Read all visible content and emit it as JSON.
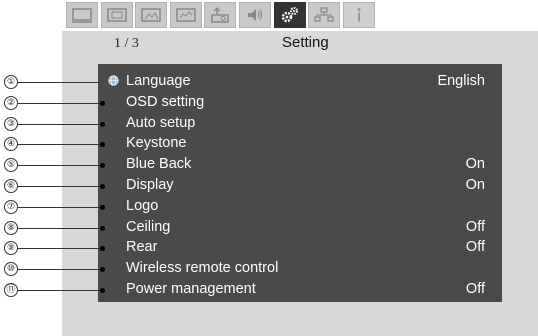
{
  "tabs": [
    {
      "icon": "picture-adjust-icon",
      "active": false
    },
    {
      "icon": "screen-adjust-icon",
      "active": false
    },
    {
      "icon": "image-icon",
      "active": false
    },
    {
      "icon": "input-select-icon",
      "active": false
    },
    {
      "icon": "projector-icon",
      "active": false
    },
    {
      "icon": "sound-icon",
      "active": false
    },
    {
      "icon": "setting-gears-icon",
      "active": true
    },
    {
      "icon": "network-icon",
      "active": false
    },
    {
      "icon": "info-icon",
      "active": false
    }
  ],
  "header": {
    "page_indicator": "1 / 3",
    "title": "Setting"
  },
  "menu": [
    {
      "callout": "①",
      "label": "Language",
      "value": "English"
    },
    {
      "callout": "②",
      "label": "OSD setting",
      "value": ""
    },
    {
      "callout": "③",
      "label": "Auto setup",
      "value": ""
    },
    {
      "callout": "④",
      "label": "Keystone",
      "value": ""
    },
    {
      "callout": "⑤",
      "label": "Blue Back",
      "value": "On"
    },
    {
      "callout": "⑥",
      "label": "Display",
      "value": "On"
    },
    {
      "callout": "⑦",
      "label": "Logo",
      "value": ""
    },
    {
      "callout": "⑧",
      "label": "Ceiling",
      "value": "Off"
    },
    {
      "callout": "⑨",
      "label": "Rear",
      "value": "Off"
    },
    {
      "callout": "⑩",
      "label": "Wireless remote control",
      "value": ""
    },
    {
      "callout": "⑪",
      "label": "Power management",
      "value": "Off"
    }
  ],
  "colors": {
    "panel": "#4a4a4a",
    "frame": "#d8d8d8",
    "active_tab": "#333333",
    "text": "#ffffff"
  }
}
